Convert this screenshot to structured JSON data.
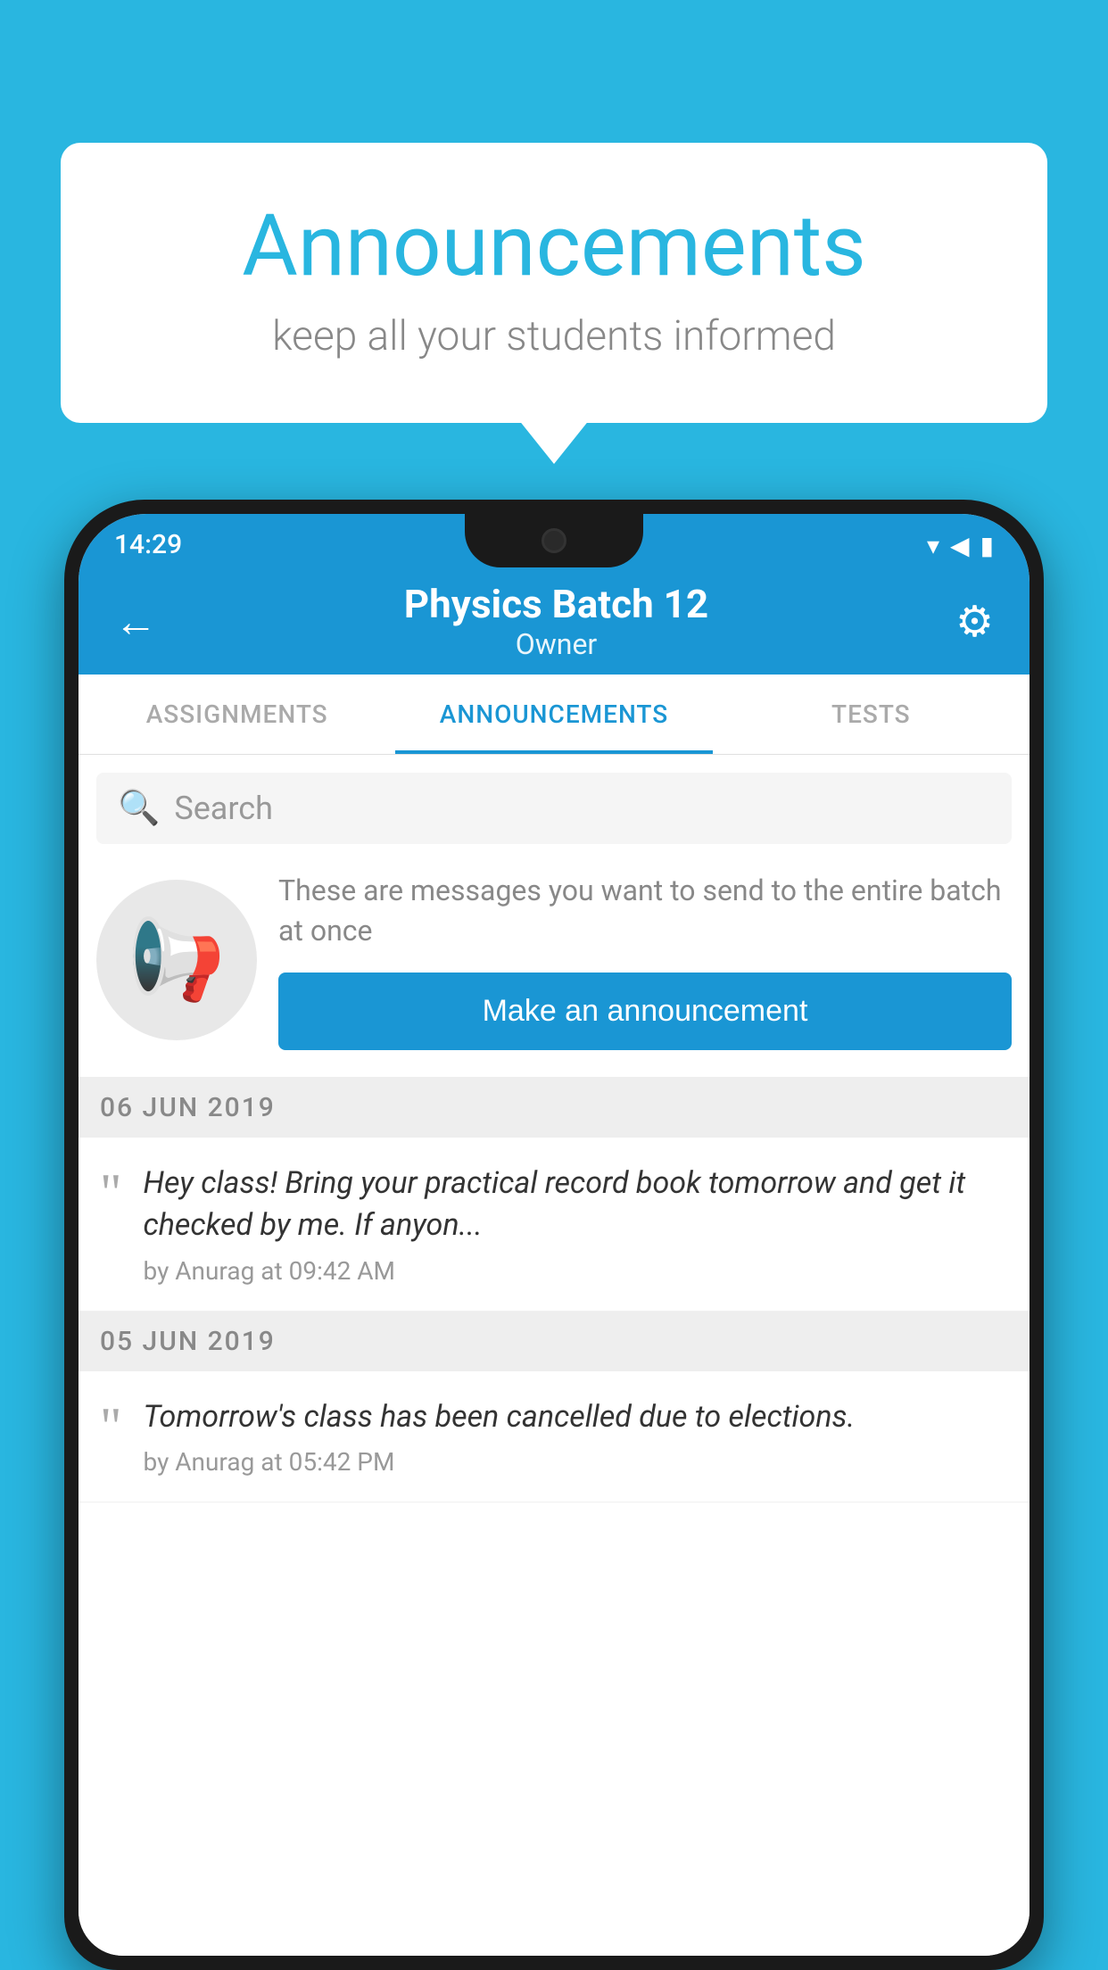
{
  "bubble": {
    "title": "Announcements",
    "subtitle": "keep all your students informed"
  },
  "status_bar": {
    "time": "14:29",
    "wifi": "▼",
    "signal": "▲",
    "battery": "▮"
  },
  "app_bar": {
    "title": "Physics Batch 12",
    "subtitle": "Owner",
    "back_label": "←",
    "settings_label": "⚙"
  },
  "tabs": [
    {
      "label": "ASSIGNMENTS",
      "active": false
    },
    {
      "label": "ANNOUNCEMENTS",
      "active": true
    },
    {
      "label": "TESTS",
      "active": false
    }
  ],
  "search": {
    "placeholder": "Search"
  },
  "announcement_prompt": {
    "description": "These are messages you want to send to the entire batch at once",
    "button_label": "Make an announcement"
  },
  "announcement_groups": [
    {
      "date": "06  JUN  2019",
      "items": [
        {
          "text": "Hey class! Bring your practical record book tomorrow and get it checked by me. If anyon...",
          "meta": "by Anurag at 09:42 AM"
        }
      ]
    },
    {
      "date": "05  JUN  2019",
      "items": [
        {
          "text": "Tomorrow's class has been cancelled due to elections.",
          "meta": "by Anurag at 05:42 PM"
        }
      ]
    }
  ],
  "colors": {
    "brand": "#29b6e0",
    "app_bar": "#1a96d4",
    "button": "#1a96d4"
  }
}
